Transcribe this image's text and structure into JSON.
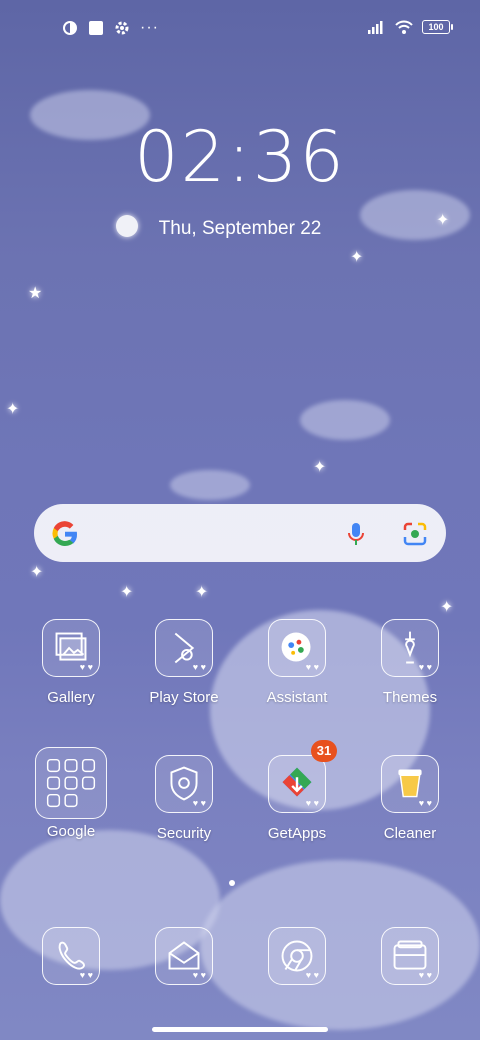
{
  "status_bar": {
    "left_icons": [
      "notification-app-icon",
      "square-notification-icon",
      "gear-icon",
      "more-dots-icon"
    ],
    "right_icons": [
      "signal-icon",
      "wifi-icon"
    ],
    "battery": "100"
  },
  "lockscreen": {
    "time": "02:36",
    "date": "Thu, September 22"
  },
  "search_bar": {
    "icons": [
      "google-g-icon",
      "microphone-icon",
      "google-lens-icon"
    ]
  },
  "apps": [
    {
      "label": "Gallery",
      "icon": "gallery-icon"
    },
    {
      "label": "Play Store",
      "icon": "play-store-icon"
    },
    {
      "label": "Assistant",
      "icon": "assistant-icon"
    },
    {
      "label": "Themes",
      "icon": "themes-icon"
    },
    {
      "label": "Google",
      "icon": "google-folder-icon"
    },
    {
      "label": "Security",
      "icon": "security-icon"
    },
    {
      "label": "GetApps",
      "icon": "getapps-icon",
      "badge": "31"
    },
    {
      "label": "Cleaner",
      "icon": "cleaner-icon"
    }
  ],
  "dock": [
    {
      "icon": "phone-icon"
    },
    {
      "icon": "messages-icon"
    },
    {
      "icon": "chrome-icon"
    },
    {
      "icon": "camera-icon"
    }
  ],
  "colors": {
    "badge": "#e8511e",
    "background": "#6c73b2"
  }
}
